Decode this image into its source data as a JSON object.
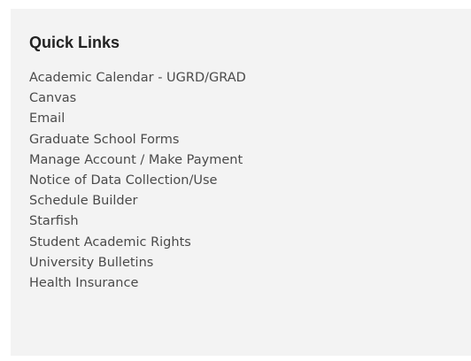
{
  "quick_links": {
    "title": "Quick Links",
    "items": [
      {
        "label": "Academic Calendar - UGRD/GRAD"
      },
      {
        "label": "Canvas"
      },
      {
        "label": "Email"
      },
      {
        "label": "Graduate School Forms"
      },
      {
        "label": "Manage Account / Make Payment"
      },
      {
        "label": "Notice of Data Collection/Use"
      },
      {
        "label": "Schedule Builder"
      },
      {
        "label": "Starfish"
      },
      {
        "label": "Student Academic Rights"
      },
      {
        "label": "University Bulletins"
      },
      {
        "label": "Health Insurance"
      }
    ]
  }
}
